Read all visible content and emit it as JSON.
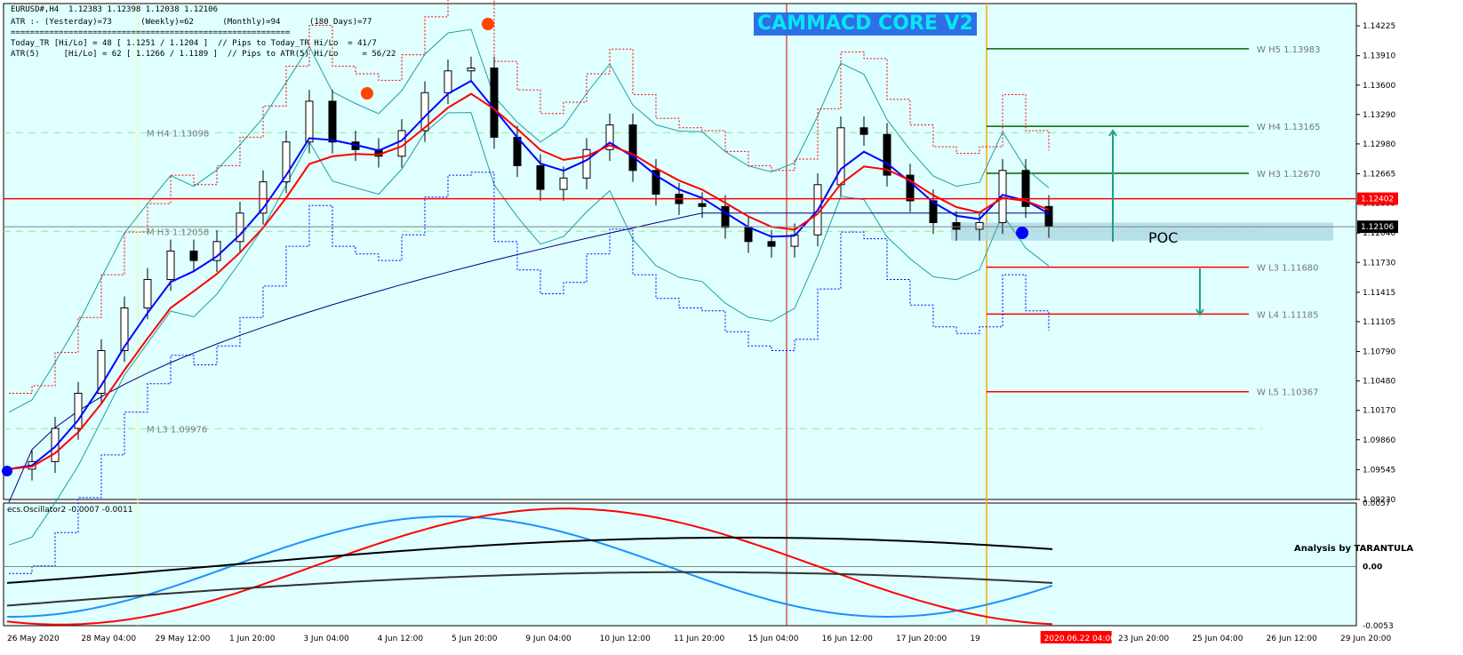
{
  "header": {
    "symbol_line": "EURUSD#,H4  1.12383 1.12398 1.12038 1.12106",
    "atr_line": "ATR :- (Yesterday)=73      (Weekly)=62      (Monthly)=94      (180 Days)=77",
    "separator": "==========================================================",
    "today_line": "Today_TR [Hi/Lo] = 48 [ 1.1251 / 1.1204 ]  // Pips to Today_TR Hi/Lo  = 41/7",
    "atr5_line": "ATR(5)     [Hi/Lo] = 62 [ 1.1266 / 1.1189 ]  // Pips to ATR(5) Hi/Lo     = 56/22"
  },
  "brand_label": "CAMMACD CORE V2",
  "credit_label": "Analysis by TARANTULA",
  "oscillator_title": "ecs.Oscillator2 -0.0007 -0.0011",
  "poc_label": "POC",
  "colors": {
    "background": "#e0ffff",
    "bull_candle": "#ffffff",
    "bear_candle": "#000000",
    "ema_fast": "#0000ff",
    "ema_slow": "#ff0000",
    "bollinger": "#20a0a0",
    "ma_long": "#000080",
    "resistance": "#006400",
    "support": "#ff0000",
    "price_marker": "#ff0000",
    "current_marker": "#000000",
    "separator_orange": "#ffa500",
    "osc_blue": "#1e90ff",
    "osc_red": "#ff0000",
    "poc_band": "#add8e6"
  },
  "chart_data": {
    "type": "candlestick",
    "symbol": "EURUSD#",
    "timeframe": "H4",
    "ylim": [
      1.0923,
      1.1446
    ],
    "y_ticks": [
      "1.14225",
      "1.13910",
      "1.13600",
      "1.13290",
      "1.12980",
      "1.12665",
      "1.12355",
      "1.12040",
      "1.11730",
      "1.11415",
      "1.11105",
      "1.10790",
      "1.10480",
      "1.10170",
      "1.09860",
      "1.09545",
      "1.09230"
    ],
    "x_ticks": [
      "26 May 2020",
      "28 May 04:00",
      "29 May 12:00",
      "1 Jun 20:00",
      "3 Jun 04:00",
      "4 Jun 12:00",
      "5 Jun 20:00",
      "9 Jun 04:00",
      "10 Jun 12:00",
      "11 Jun 20:00",
      "15 Jun 04:00",
      "16 Jun 12:00",
      "17 Jun 20:00",
      "19",
      "2020.06.22 04:00",
      "23 Jun 20:00",
      "25 Jun 04:00",
      "26 Jun 12:00",
      "29 Jun 20:00"
    ],
    "highlight_tick": "2020.06.22 04:00",
    "current_price": "1.12106",
    "marked_price": "1.12402",
    "close_path": [
      1.0955,
      1.0963,
      1.0998,
      1.1035,
      1.108,
      1.1125,
      1.1155,
      1.1185,
      1.1175,
      1.1195,
      1.1225,
      1.1258,
      1.13,
      1.1343,
      1.13,
      1.1292,
      1.1285,
      1.1312,
      1.1352,
      1.1375,
      1.1378,
      1.1305,
      1.1275,
      1.125,
      1.1262,
      1.1292,
      1.1318,
      1.127,
      1.1245,
      1.1235,
      1.1232,
      1.121,
      1.1195,
      1.119,
      1.1202,
      1.1255,
      1.1315,
      1.1308,
      1.1265,
      1.1238,
      1.1215,
      1.1208,
      1.1215,
      1.127,
      1.1232,
      1.1211
    ],
    "pivots": [
      {
        "label": "W  H5 1.13983",
        "value": 1.13983,
        "kind": "resistance"
      },
      {
        "label": "W  H4 1.13165",
        "value": 1.13165,
        "kind": "resistance"
      },
      {
        "label": "W  H3 1.12670",
        "value": 1.1267,
        "kind": "resistance"
      },
      {
        "label": "W  L3 1.11680",
        "value": 1.1168,
        "kind": "support"
      },
      {
        "label": "W  L4 1.11185",
        "value": 1.11185,
        "kind": "support"
      },
      {
        "label": "W  L5 1.10367",
        "value": 1.10367,
        "kind": "support"
      }
    ],
    "monthly_labels": [
      {
        "label": "M  H4 1.13098",
        "value": 1.13098
      },
      {
        "label": "M  H3 1.12058",
        "value": 1.12058
      },
      {
        "label": "M  L3 1.09976",
        "value": 1.09976
      }
    ],
    "oscillator": {
      "ylim": [
        -0.0053,
        0.0057
      ],
      "y_ticks": [
        "0.0057",
        "0.00",
        "-0.0053"
      ],
      "zero_label": "0.00"
    }
  }
}
